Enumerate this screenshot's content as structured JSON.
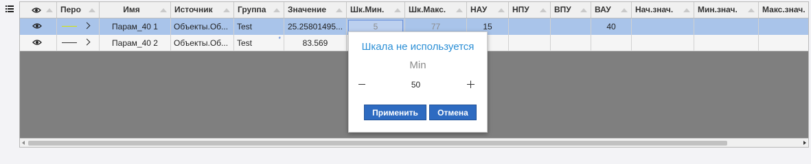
{
  "columns": [
    {
      "label": ""
    },
    {
      "label": "Перо"
    },
    {
      "label": "Имя"
    },
    {
      "label": "Источник"
    },
    {
      "label": "Группа"
    },
    {
      "label": "Значение"
    },
    {
      "label": "Шк.Мин."
    },
    {
      "label": "Шк.Макс."
    },
    {
      "label": "НАУ"
    },
    {
      "label": "НПУ"
    },
    {
      "label": "ВПУ"
    },
    {
      "label": "ВАУ"
    },
    {
      "label": "Нач.знач."
    },
    {
      "label": "Мин.знач."
    },
    {
      "label": "Макс.знач."
    }
  ],
  "rows": [
    {
      "pen_color": "#d4e600",
      "name": "Парам_40 1",
      "source": "Объекты.Об...",
      "group": "Test",
      "value": "25.25801495...",
      "scale_min": "5",
      "scale_max": "77",
      "nau": "15",
      "npu": "",
      "vpu": "",
      "vau": "40",
      "init": "",
      "min": "",
      "max": ""
    },
    {
      "pen_color": "#333333",
      "name": "Парам_40 2",
      "source": "Объекты.Об...",
      "group": "Test",
      "value": "83.569",
      "scale_min": "",
      "scale_max": "",
      "nau": "",
      "npu": "",
      "vpu": "",
      "vau": "",
      "init": "",
      "min": "",
      "max": ""
    }
  ],
  "popup": {
    "title": "Шкала не используется",
    "field_label": "Min",
    "value": "50",
    "apply_label": "Применить",
    "cancel_label": "Отмена"
  },
  "colors": {
    "selected_row": "#a9c4ea",
    "accent": "#2e6bc1",
    "title": "#2b8fd6"
  }
}
